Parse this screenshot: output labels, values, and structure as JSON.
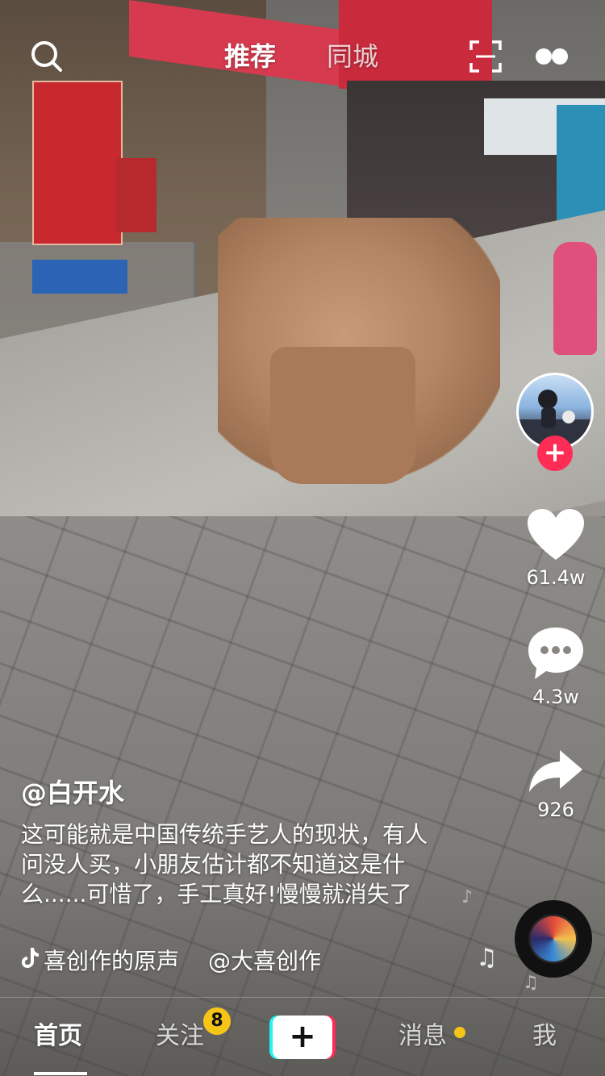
{
  "top_tabs": {
    "recommend": "推荐",
    "nearby": "同城"
  },
  "right_rail": {
    "like_count": "61.4w",
    "comment_count": "4.3w",
    "share_count": "926"
  },
  "post": {
    "author": "@白开水",
    "caption": "这可能就是中国传统手艺人的现状，有人问没人买，小朋友估计都不知道这是什么......可惜了，手工真好!慢慢就消失了",
    "music_title": "喜创作的原声",
    "music_author": "@大喜创作"
  },
  "bottom_nav": {
    "home": "首页",
    "following": "关注",
    "following_badge": "8",
    "messages": "消息",
    "me": "我"
  },
  "colors": {
    "accent_red": "#fe2c55",
    "accent_cyan": "#25f4ee",
    "badge_yellow": "#f5c518"
  },
  "icons": [
    "search-icon",
    "scan-icon",
    "more-icon",
    "heart-icon",
    "comment-icon",
    "share-icon",
    "music-note-icon",
    "tiktok-logo-icon",
    "plus-icon"
  ]
}
